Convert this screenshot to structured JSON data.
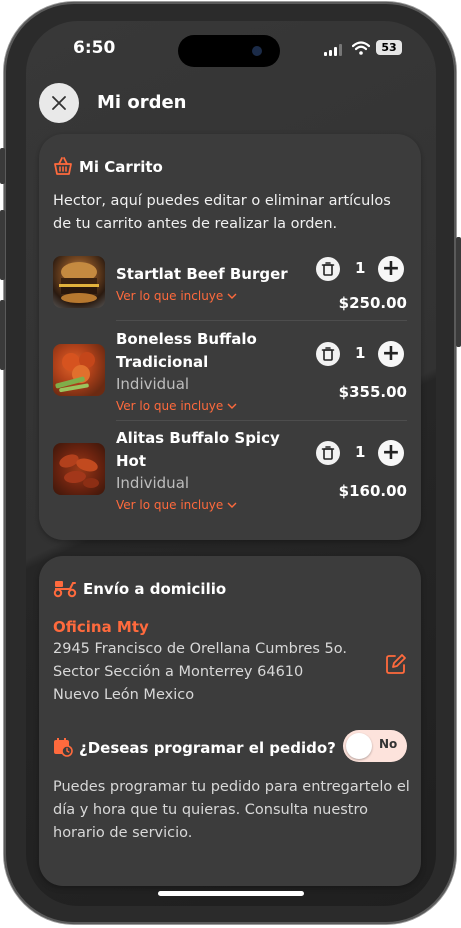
{
  "status": {
    "time": "6:50",
    "battery": "53"
  },
  "header": {
    "title": "Mi orden",
    "close_icon": "close-icon"
  },
  "cart": {
    "title": "Mi Carrito",
    "description": "Hector, aquí puedes editar o eliminar artículos de tu carrito antes de realizar la orden.",
    "link_text": "Ver lo que incluye",
    "items": [
      {
        "name": "Startlat Beef Burger",
        "variant": "",
        "quantity": "1",
        "price": "$250.00",
        "image": "burger-image"
      },
      {
        "name": "Boneless Buffalo Tradicional",
        "variant": "Individual",
        "quantity": "1",
        "price": "$355.00",
        "image": "boneless-image"
      },
      {
        "name": "Alitas Buffalo Spicy Hot",
        "variant": "Individual",
        "quantity": "1",
        "price": "$160.00",
        "image": "wings-image"
      }
    ]
  },
  "shipping": {
    "title": "Envío a domicilio",
    "place_name": "Oficina Mty",
    "address_line1": "2945 Francisco de Orellana Cumbres 5o.",
    "address_line2": "Sector Sección a Monterrey 64610",
    "address_line3": "Nuevo León Mexico",
    "schedule_question": "¿Deseas programar el pedido?",
    "schedule_toggle": "No",
    "schedule_text": "Puedes programar tu pedido para entregartelo el día y hora que tu quieras. Consulta nuestro horario de servicio."
  },
  "colors": {
    "accent": "#ff6a3d",
    "card": "#3c3c3c",
    "toggle_bg": "#fde3dc"
  }
}
